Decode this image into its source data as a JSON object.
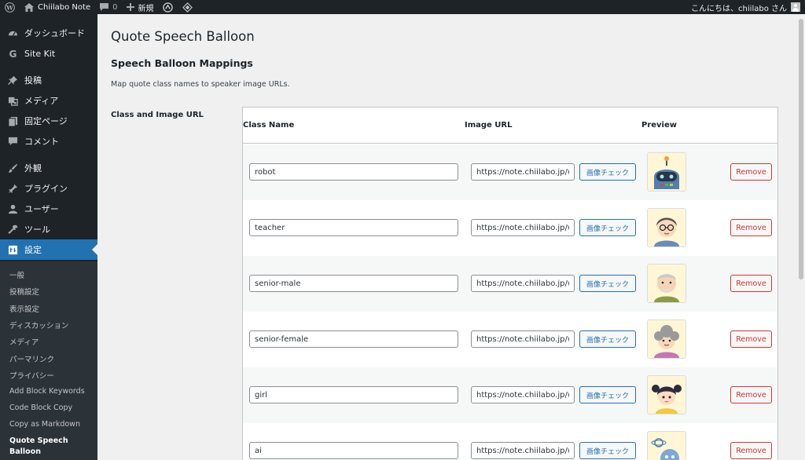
{
  "adminbar": {
    "site_name": "Chiilabo Note",
    "comments_count": "0",
    "new_label": "新規",
    "greeting": "こんにちは、chiilabo さん"
  },
  "sidebar": {
    "items": [
      {
        "label": "ダッシュボード",
        "icon": "dashboard-icon"
      },
      {
        "label": "Site Kit",
        "icon": "google-g-icon"
      },
      {
        "label": "投稿",
        "icon": "pin-icon"
      },
      {
        "label": "メディア",
        "icon": "media-icon"
      },
      {
        "label": "固定ページ",
        "icon": "page-icon"
      },
      {
        "label": "コメント",
        "icon": "comment-icon"
      },
      {
        "label": "外観",
        "icon": "brush-icon"
      },
      {
        "label": "プラグイン",
        "icon": "plugin-icon"
      },
      {
        "label": "ユーザー",
        "icon": "user-icon"
      },
      {
        "label": "ツール",
        "icon": "wrench-icon"
      },
      {
        "label": "設定",
        "icon": "settings-icon"
      }
    ],
    "submenu": [
      "一般",
      "投稿設定",
      "表示設定",
      "ディスカッション",
      "メディア",
      "パーマリンク",
      "プライバシー",
      "Add Block Keywords",
      "Code Block Copy",
      "Copy as Markdown",
      "Quote Speech Balloon"
    ]
  },
  "page": {
    "title": "Quote Speech Balloon",
    "section_title": "Speech Balloon Mappings",
    "section_desc": "Map quote class names to speaker image URLs.",
    "row_label": "Class and Image URL"
  },
  "table": {
    "headers": {
      "class_name": "Class Name",
      "image_url": "Image URL",
      "preview": "Preview"
    },
    "check_label": "画像チェック",
    "remove_label": "Remove",
    "rows": [
      {
        "class_name": "robot",
        "image_url": "https://note.chiilabo.jp/wp-content/",
        "preview_icon": "robot-avatar-icon"
      },
      {
        "class_name": "teacher",
        "image_url": "https://note.chiilabo.jp/wp-content/",
        "preview_icon": "teacher-avatar-icon"
      },
      {
        "class_name": "senior-male",
        "image_url": "https://note.chiilabo.jp/wp-content/",
        "preview_icon": "senior-male-avatar-icon"
      },
      {
        "class_name": "senior-female",
        "image_url": "https://note.chiilabo.jp/wp-content/",
        "preview_icon": "senior-female-avatar-icon"
      },
      {
        "class_name": "girl",
        "image_url": "https://note.chiilabo.jp/wp-content/",
        "preview_icon": "girl-avatar-icon"
      },
      {
        "class_name": "ai",
        "image_url": "https://note.chiilabo.jp/wp-content/",
        "preview_icon": "ai-avatar-icon"
      }
    ]
  }
}
